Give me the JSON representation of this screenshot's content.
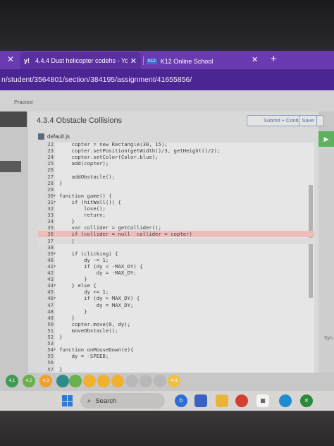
{
  "browser": {
    "tabs": [
      {
        "label": "4.4.4 Dust helicopter codehs - Yo",
        "active": true,
        "favicon": "y!"
      },
      {
        "label": "K12 Online School",
        "active": false,
        "favicon": "K12"
      }
    ],
    "new_tab": "+",
    "close_glyph": "✕",
    "address": "n/student/3564801/section/384195/assignment/41655856/"
  },
  "page": {
    "practice_label": "Practice",
    "title": "4.3.4 Obstacle Collisions",
    "submit_label": "Submit + Continue",
    "save_label": "Save",
    "file_name": "default.js",
    "right_panel_text": "Syn",
    "run_arrow": "▶"
  },
  "editor": {
    "lines": [
      {
        "n": "22",
        "fold": "",
        "code": "    copter = new Rectangle(30, 15);"
      },
      {
        "n": "23",
        "fold": "",
        "code": "    copter.setPosition(getWidth()/3, getHeight()/2);"
      },
      {
        "n": "24",
        "fold": "",
        "code": "    copter.setColor(Color.blue);"
      },
      {
        "n": "25",
        "fold": "",
        "code": "    add(copter);"
      },
      {
        "n": "26",
        "fold": "",
        "code": ""
      },
      {
        "n": "27",
        "fold": "",
        "code": "    addObstacle();"
      },
      {
        "n": "28",
        "fold": "",
        "code": "}"
      },
      {
        "n": "29",
        "fold": "",
        "code": ""
      },
      {
        "n": "30",
        "fold": "▾",
        "code": "function game() {"
      },
      {
        "n": "31",
        "fold": "▾",
        "code": "    if (hitWall()) {"
      },
      {
        "n": "32",
        "fold": "",
        "code": "        lose();"
      },
      {
        "n": "33",
        "fold": "",
        "code": "        return;"
      },
      {
        "n": "34",
        "fold": "",
        "code": "    }"
      },
      {
        "n": "35",
        "fold": "",
        "code": "    var collider = getCollider();"
      },
      {
        "n": "36",
        "fold": "",
        "code": "    if (collider = null  collider = copter)"
      },
      {
        "n": "37",
        "fold": "",
        "code": "    |"
      },
      {
        "n": "38",
        "fold": "",
        "code": ""
      },
      {
        "n": "39",
        "fold": "▾",
        "code": "    if (clicking) {"
      },
      {
        "n": "40",
        "fold": "",
        "code": "        dy -= 1;"
      },
      {
        "n": "41",
        "fold": "▾",
        "code": "        if (dy < -MAX_DY) {"
      },
      {
        "n": "42",
        "fold": "",
        "code": "            dy = -MAX_DY;"
      },
      {
        "n": "43",
        "fold": "",
        "code": "        }"
      },
      {
        "n": "44",
        "fold": "▾",
        "code": "    } else {"
      },
      {
        "n": "45",
        "fold": "",
        "code": "        dy += 1;"
      },
      {
        "n": "46",
        "fold": "▾",
        "code": "        if (dy > MAX_DY) {"
      },
      {
        "n": "47",
        "fold": "",
        "code": "            dy = MAX_DY;"
      },
      {
        "n": "48",
        "fold": "",
        "code": "        }"
      },
      {
        "n": "49",
        "fold": "",
        "code": "    }"
      },
      {
        "n": "50",
        "fold": "",
        "code": "    copter.move(0, dy);"
      },
      {
        "n": "51",
        "fold": "",
        "code": "    moveObstacle();"
      },
      {
        "n": "52",
        "fold": "",
        "code": "}"
      },
      {
        "n": "53",
        "fold": "",
        "code": ""
      },
      {
        "n": "54",
        "fold": "▾",
        "code": "function onMouseDown(e){"
      },
      {
        "n": "55",
        "fold": "",
        "code": "    dy = -SPEED;"
      },
      {
        "n": "56",
        "fold": "",
        "code": ""
      },
      {
        "n": "57",
        "fold": "",
        "code": "}"
      }
    ],
    "highlight_line": "36",
    "cursor_line": "37"
  },
  "progress": {
    "items": [
      {
        "label": "4.1",
        "color": "#3f9a52"
      },
      {
        "label": "4.2",
        "color": "#6ab04c"
      },
      {
        "label": "4.3",
        "color": "#f0a030"
      },
      {
        "label": "",
        "color": "#2f8a8a"
      },
      {
        "label": "",
        "color": "#6ab04c"
      },
      {
        "label": "",
        "color": "#f0b030"
      },
      {
        "label": "",
        "color": "#f0b030"
      },
      {
        "label": "",
        "color": "#f0b030"
      },
      {
        "label": "",
        "color": "#b8b8b8"
      },
      {
        "label": "",
        "color": "#b8b8b8"
      },
      {
        "label": "",
        "color": "#b8b8b8"
      },
      {
        "label": "4.4",
        "color": "#f0c040"
      }
    ]
  },
  "taskbar": {
    "search_label": "Search",
    "apps": [
      "copilot-icon",
      "news-icon",
      "file-explorer-icon",
      "chrome-icon",
      "store-icon",
      "edge-icon",
      "xbox-icon"
    ]
  }
}
